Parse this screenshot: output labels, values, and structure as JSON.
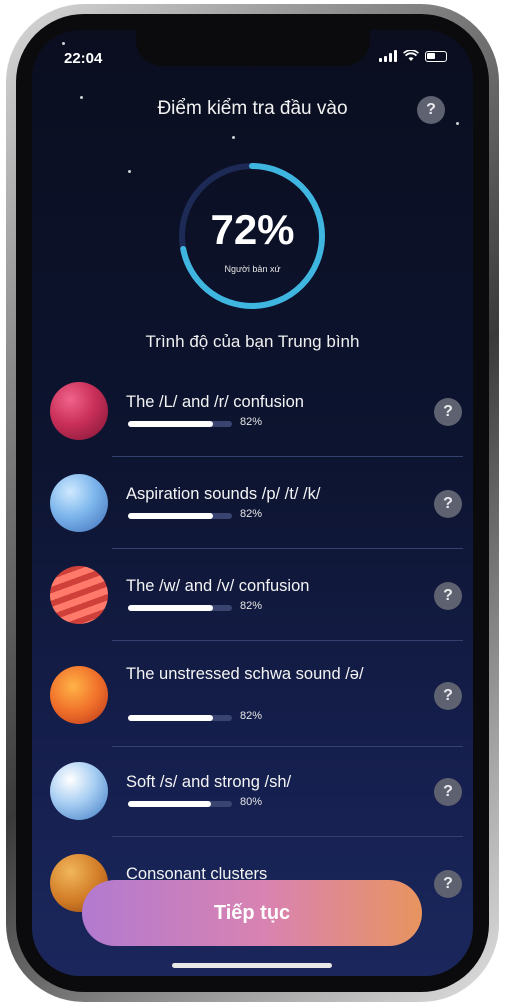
{
  "status_bar": {
    "time": "22:04"
  },
  "header": {
    "title": "Điểm kiểm tra đầu vào",
    "help": "?"
  },
  "score": {
    "value": "72%",
    "percent": 72,
    "caption": "Người bản xứ",
    "level_text": "Trình độ của bạn Trung bình",
    "ring_color": "#3fb6e0"
  },
  "items": [
    {
      "title": "The /L/ and /r/ confusion",
      "percent_label": "82%",
      "percent": 82,
      "help": "?"
    },
    {
      "title": "Aspiration sounds /p/ /t/ /k/",
      "percent_label": "82%",
      "percent": 82,
      "help": "?"
    },
    {
      "title": "The /w/ and /v/ confusion",
      "percent_label": "82%",
      "percent": 82,
      "help": "?"
    },
    {
      "title": "The unstressed schwa sound /ə/",
      "percent_label": "82%",
      "percent": 82,
      "help": "?"
    },
    {
      "title": "Soft /s/ and strong /sh/",
      "percent_label": "80%",
      "percent": 80,
      "help": "?"
    },
    {
      "title": "Consonant clusters",
      "help": "?"
    }
  ],
  "cta": {
    "label": "Tiếp tục"
  },
  "colors": {
    "accent_gradient_start": "#b27ad0",
    "accent_gradient_end": "#e8945f",
    "background": "#0d1430"
  }
}
